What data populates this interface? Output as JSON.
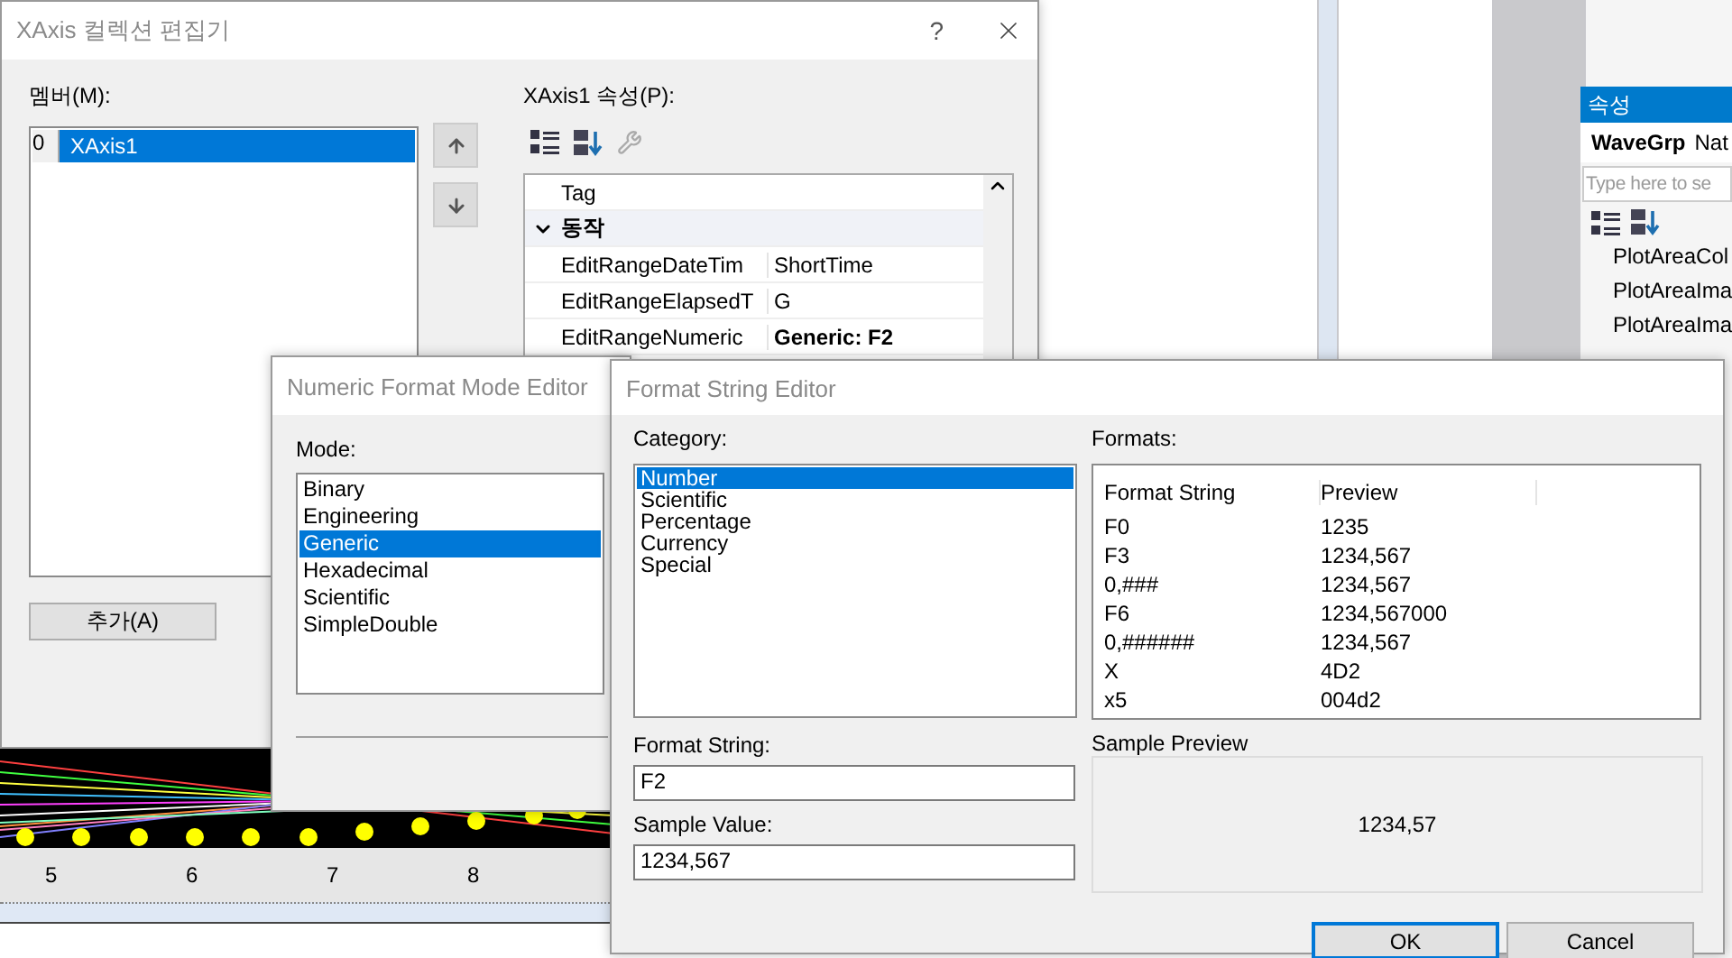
{
  "collection_editor": {
    "title": "XAxis 컬렉션 편집기",
    "help": "?",
    "members_label": "멤버(M):",
    "members": [
      {
        "index": "0",
        "name": "XAxis1",
        "selected": true
      }
    ],
    "properties_label": "XAxis1 속성(P):",
    "property_rows": [
      {
        "kind": "property",
        "name": "Tag"
      },
      {
        "kind": "category",
        "name": "동작",
        "expanded": true
      },
      {
        "kind": "property",
        "name": "EditRangeDateTim",
        "value": "ShortTime",
        "bold": false
      },
      {
        "kind": "property",
        "name": "EditRangeElapsedT",
        "value": "G",
        "bold": false
      },
      {
        "kind": "property",
        "name": "EditRangeNumeric",
        "value": "Generic: F2",
        "bold": true
      }
    ],
    "add_button": "추가(A)"
  },
  "numeric_mode_editor": {
    "title": "Numeric Format Mode Editor",
    "mode_label": "Mode:",
    "modes": [
      {
        "label": "Binary",
        "selected": false
      },
      {
        "label": "Engineering",
        "selected": false
      },
      {
        "label": "Generic",
        "selected": true
      },
      {
        "label": "Hexadecimal",
        "selected": false
      },
      {
        "label": "Scientific",
        "selected": false
      },
      {
        "label": "SimpleDouble",
        "selected": false
      }
    ]
  },
  "format_string_editor": {
    "title": "Format String Editor",
    "category_label": "Category:",
    "categories": [
      {
        "label": "Number",
        "selected": true
      },
      {
        "label": "Scientific",
        "selected": false
      },
      {
        "label": "Percentage",
        "selected": false
      },
      {
        "label": "Currency",
        "selected": false
      },
      {
        "label": "Special",
        "selected": false
      }
    ],
    "formats_label": "Formats:",
    "formats_columns": [
      "Format String",
      "Preview"
    ],
    "formats": [
      {
        "format": "F0",
        "preview": "1235"
      },
      {
        "format": "F3",
        "preview": "1234,567"
      },
      {
        "format": "0,###",
        "preview": "1234,567"
      },
      {
        "format": "F6",
        "preview": "1234,567000"
      },
      {
        "format": "0,######",
        "preview": "1234,567"
      },
      {
        "format": "X",
        "preview": "4D2"
      },
      {
        "format": "x5",
        "preview": "004d2"
      }
    ],
    "format_string_label": "Format String:",
    "format_string": "F2",
    "sample_value_label": "Sample Value:",
    "sample_value": "1234,567",
    "sample_preview_label": "Sample Preview",
    "sample_preview": "1234,57",
    "buttons": [
      {
        "label": "OK",
        "default": true
      },
      {
        "label": "Cancel",
        "default": false
      }
    ]
  },
  "properties_panel": {
    "title": "속성",
    "object": "WaveGrp",
    "object_type": "Nat",
    "search_placeholder": "Type here to se",
    "rows": [
      "PlotAreaCol",
      "PlotAreaIma",
      "PlotAreaIma"
    ]
  },
  "chart": {
    "x_labels": [
      "5",
      "6",
      "7",
      "8"
    ]
  }
}
